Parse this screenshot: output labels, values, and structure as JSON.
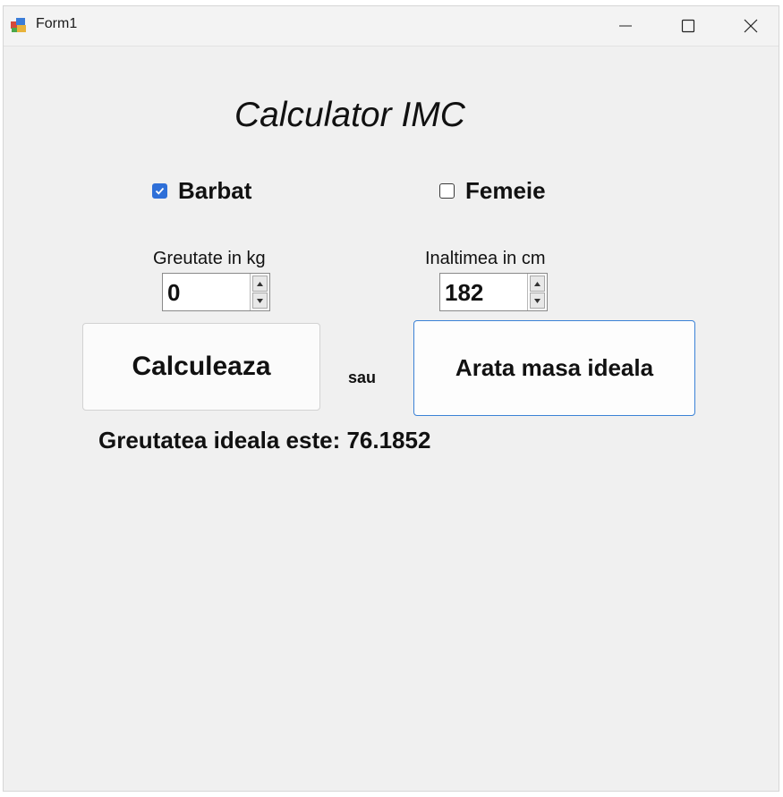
{
  "window": {
    "title": "Form1",
    "controls": {
      "minimize_icon": "minimize-icon",
      "maximize_icon": "maximize-icon",
      "close_icon": "close-icon"
    }
  },
  "form": {
    "heading": "Calculator IMC",
    "gender": {
      "male": {
        "label": "Barbat",
        "checked": true
      },
      "female": {
        "label": "Femeie",
        "checked": false
      }
    },
    "weight": {
      "label": "Greutate in kg",
      "value": "0"
    },
    "height": {
      "label": "Inaltimea in cm",
      "value": "182"
    },
    "calculate_button": "Calculeaza",
    "or_label": "sau",
    "ideal_button": "Arata masa ideala",
    "result": "Greutatea ideala este: 76.1852"
  },
  "colors": {
    "accent": "#2e6fd8",
    "focus_border": "#3b82d6",
    "window_bg": "#f0f0f0"
  }
}
